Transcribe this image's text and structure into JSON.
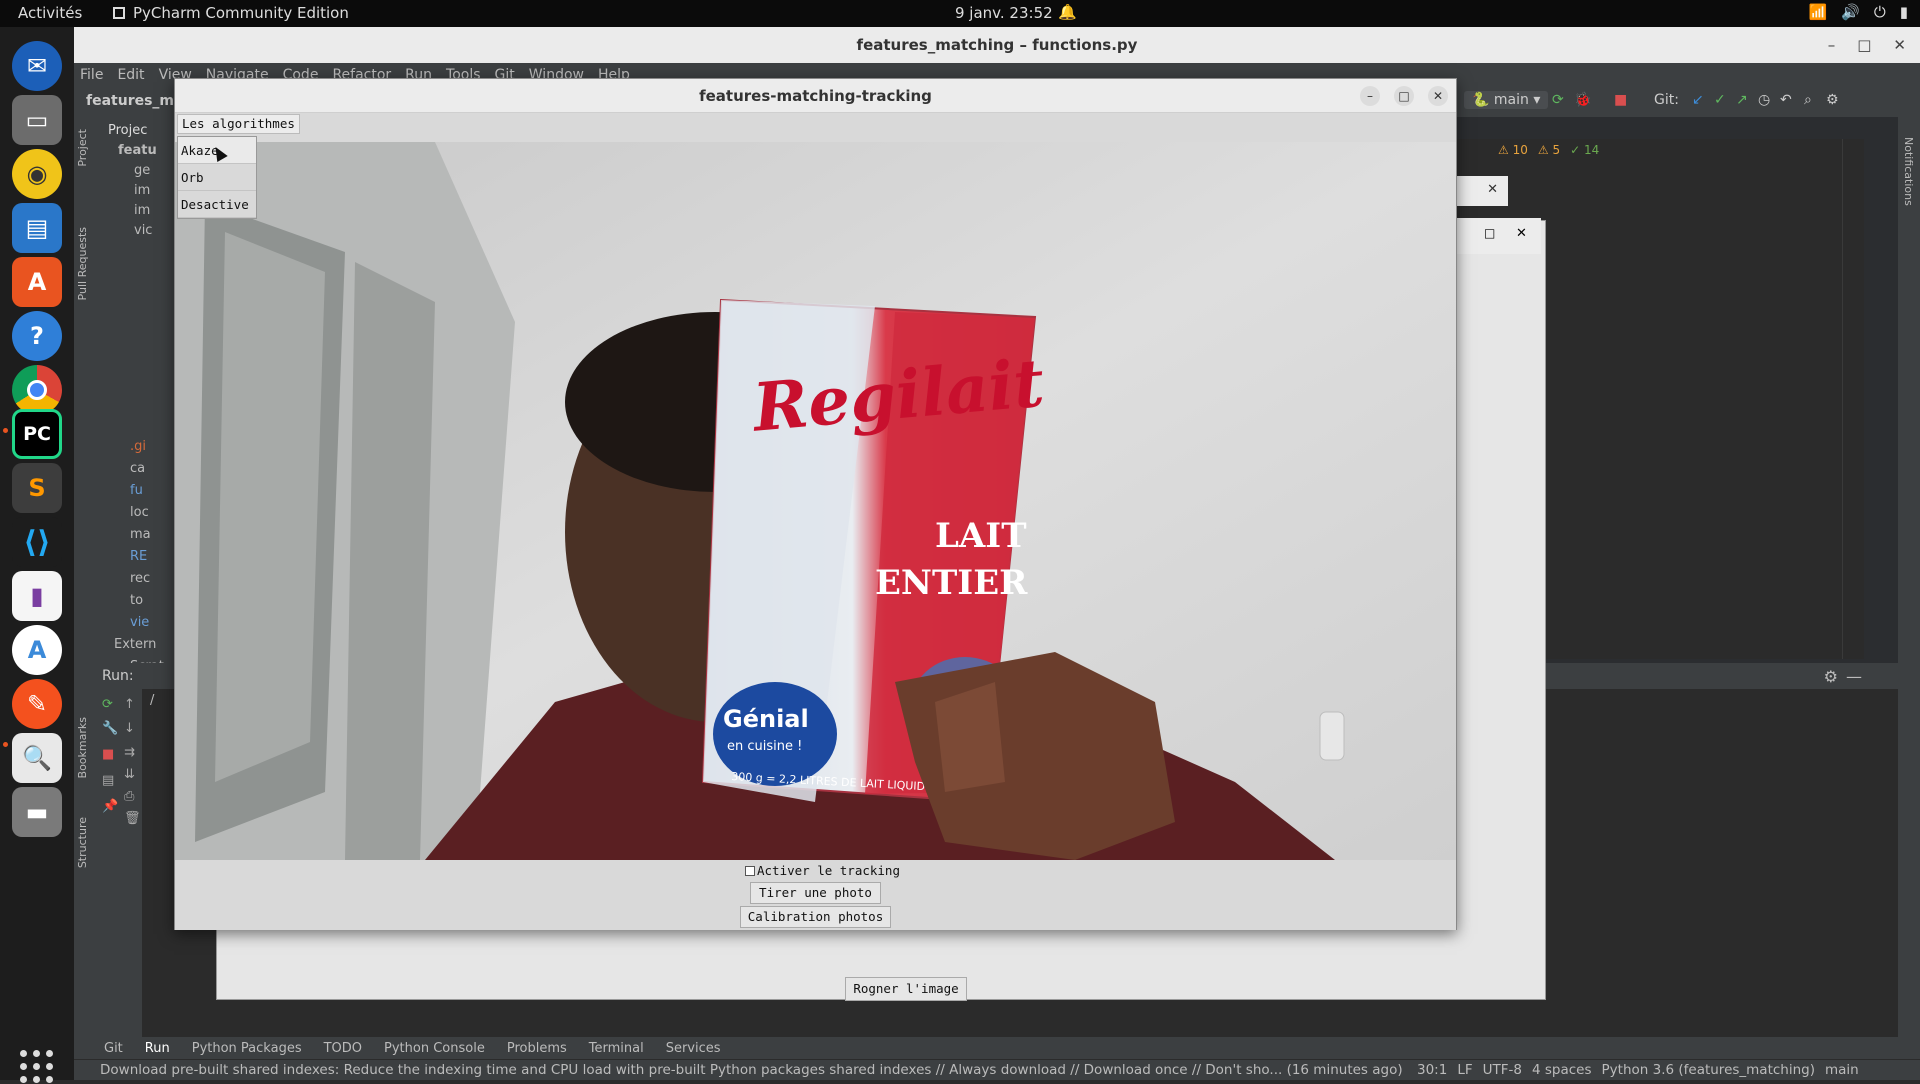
{
  "topbar": {
    "activities": "Activités",
    "app_name": "PyCharm Community Edition",
    "clock": "9 janv.  23:52"
  },
  "pycharm": {
    "window_title": "features_matching – functions.py",
    "menu": [
      "File",
      "Edit",
      "View",
      "Navigate",
      "Code",
      "Refactor",
      "Run",
      "Tools",
      "Git",
      "Window",
      "Help"
    ],
    "project_name": "features_ma",
    "branch": "main",
    "git_label": "Git:",
    "project_tab": "Projec",
    "tree_items": [
      "featu",
      "ge",
      "im",
      "im",
      "vic",
      ".gi",
      "ca",
      "fu",
      "loc",
      "ma",
      "RE",
      "rec",
      "to",
      "vie",
      "Extern",
      "Scrat"
    ],
    "inspections": {
      "warnings": "10",
      "weak": "5",
      "ok": "14"
    },
    "run_label": "Run:",
    "run_output_prefix": "/",
    "left_strip": [
      "Project",
      "Pull Requests",
      "Bookmarks",
      "Structure"
    ],
    "right_strip": "Notifications",
    "bottom_tabs": [
      "Git",
      "Run",
      "Python Packages",
      "TODO",
      "Python Console",
      "Problems",
      "Terminal",
      "Services"
    ],
    "status_message": "Download pre-built shared indexes: Reduce the indexing time and CPU load with pre-built Python packages shared indexes // Always download // Download once // Don't sho... (16 minutes ago)",
    "status_info": [
      "30:1",
      "LF",
      "UTF-8",
      "4 spaces",
      "Python 3.6 (features_matching)",
      "main"
    ]
  },
  "back_window": {
    "crop_button": "Rogner l'image"
  },
  "app_window": {
    "title": "features-matching-tracking",
    "menu_button": "Les algorithmes",
    "dropdown_items": [
      "Akaze",
      "Orb",
      "Desactive"
    ],
    "tracking_checkbox": "Activer le tracking",
    "photo_button": "Tirer une photo",
    "calibration_button": "Calibration photos"
  },
  "carton": {
    "brand": "Regilait",
    "line1": "LAIT",
    "line2": "ENTIER",
    "badge1": "Génial",
    "badge2": "en cuisine !",
    "bottom": "300 g = 2,2 LITRES DE LAIT LIQUIDE"
  },
  "colors": {
    "pycharm_bg": "#2b2d30",
    "panel": "#3c3f41",
    "brand_red": "#c8102e",
    "warning": "#e8a33d",
    "ok": "#6aa84f"
  }
}
